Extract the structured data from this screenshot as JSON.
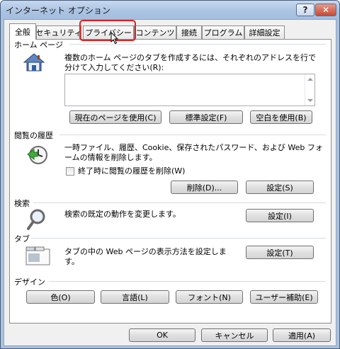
{
  "window": {
    "title": "インターネット オプション",
    "help_label": "?",
    "close_label": "✕"
  },
  "tabs": [
    {
      "label": "全般",
      "active": true
    },
    {
      "label": "セキュリティ",
      "active": false
    },
    {
      "label": "プライバシー",
      "active": false
    },
    {
      "label": "コンテンツ",
      "active": false
    },
    {
      "label": "接続",
      "active": false
    },
    {
      "label": "プログラム",
      "active": false
    },
    {
      "label": "詳細設定",
      "active": false
    }
  ],
  "home": {
    "title": "ホーム ページ",
    "desc": "複数のホーム ページのタブを作成するには、それぞれのアドレスを行で分けて入力してください(R):",
    "url_value": "",
    "btn_current": "現在のページを使用(C)",
    "btn_default": "標準設定(F)",
    "btn_blank": "空白を使用(B)"
  },
  "history": {
    "title": "閲覧の履歴",
    "desc": "一時ファイル、履歴、Cookie、保存されたパスワード、および Web フォームの情報を削除します。",
    "checkbox_label": "終了時に閲覧の履歴を削除(W)",
    "btn_delete": "削除(D)...",
    "btn_settings": "設定(S)"
  },
  "search": {
    "title": "検索",
    "desc": "検索の既定の動作を変更します。",
    "btn_settings": "設定(I)"
  },
  "tabsgroup": {
    "title": "タブ",
    "desc": "タブの中の Web ページの表示方法を設定します。",
    "btn_settings": "設定(T)"
  },
  "design": {
    "title": "デザイン",
    "btn_colors": "色(O)",
    "btn_languages": "言語(L)",
    "btn_fonts": "フォント(N)",
    "btn_accessibility": "ユーザー補助(E)"
  },
  "footer": {
    "ok": "OK",
    "cancel": "キャンセル",
    "apply": "適用(A)"
  },
  "icons": {
    "home": "house-icon",
    "history": "clock-arrow-icon",
    "search": "magnifier-icon",
    "tabs": "tab-window-icon"
  }
}
